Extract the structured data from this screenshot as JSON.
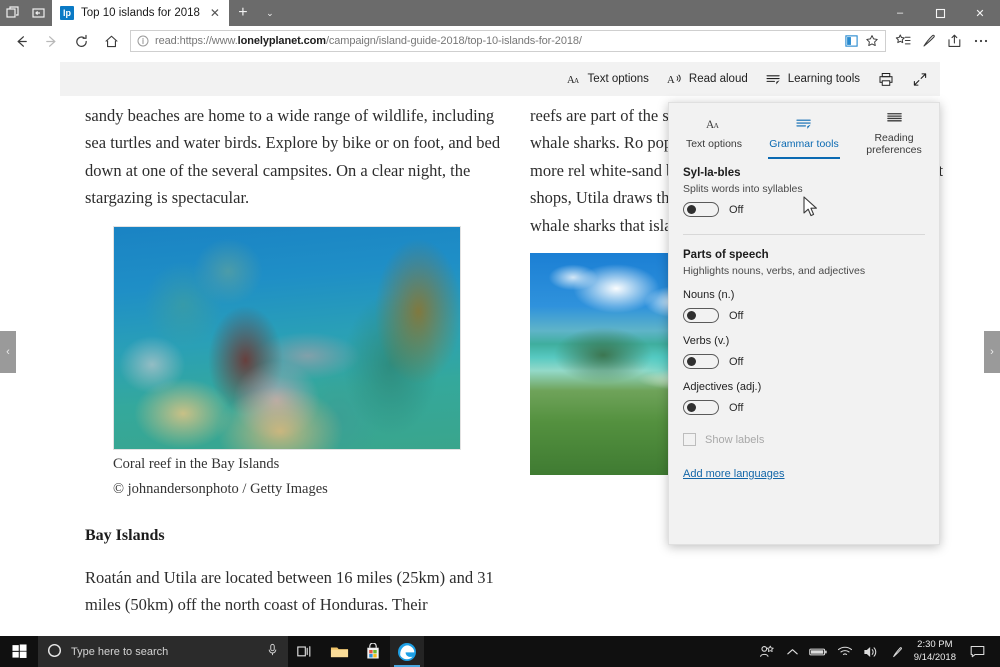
{
  "window": {
    "controls": {
      "minimize": "–",
      "maximize": "❐",
      "close": "✕"
    }
  },
  "tabbar": {
    "tab_title": "Top 10 islands for 2018",
    "favicon_text": "lp",
    "close_label": "✕",
    "new_tab_label": "+",
    "tab_menu_caret": "⌄"
  },
  "navbar": {
    "back_label": "←",
    "forward_label": "→",
    "refresh_label": "⟳",
    "home_label": "⌂",
    "url_prefix": "read:https://www.",
    "url_domain": "lonelyplanet.com",
    "url_path": "/campaign/island-guide-2018/top-10-islands-for-2018/",
    "url_full": "read:https://www.lonelyplanet.com/campaign/island-guide-2018/top-10-islands-for-2018/",
    "reading_view_title": "Reading view",
    "favorite_title": "Add to favorites",
    "favorites_hub_title": "Favorites",
    "web_note_title": "Make a Web Note",
    "share_title": "Share",
    "settings_title": "Settings and more"
  },
  "readbar": {
    "items": [
      {
        "label": "Text options",
        "icon": "text-options-icon"
      },
      {
        "label": "Read aloud",
        "icon": "read-aloud-icon"
      },
      {
        "label": "Learning tools",
        "icon": "learning-tools-icon"
      }
    ],
    "print_title": "Print",
    "fullscreen_title": "Full screen"
  },
  "sidenav": {
    "prev": "‹",
    "next": "›"
  },
  "article": {
    "left_paragraph": "sandy beaches are home to a wide range of wildlife, including sea turtles and water birds. Explore by bike or on foot, and bed down at one of the several campsites. On a clear night, the stargazing is spectacular.",
    "figure_caption": "Coral reef in the Bay Islands",
    "figure_credit": "© johnandersonphoto / Getty Images",
    "section_heading": "Bay Islands",
    "left_paragraph_2": "Roatán and Utila are located between 16 miles (25km) and 31 miles (50km) off the north coast of Honduras. Their",
    "right_paragraph": "reefs are part of the secon world, and teem with fish and even whale sharks. Ro popular of the group and i snorkeling. For a more rel white-sand beach of the W beaches and dozens of hot shops, Utila draws the bac fantastic diving spots, and juvenile whale sharks that island."
  },
  "flyout": {
    "tabs": [
      {
        "label": "Text options",
        "icon": "text-options-icon",
        "active": false
      },
      {
        "label": "Grammar tools",
        "icon": "grammar-tools-icon",
        "active": true
      },
      {
        "label": "Reading preferences",
        "icon": "reading-preferences-icon",
        "active": false
      }
    ],
    "syllables": {
      "heading": "Syl-la-bles",
      "description": "Splits words into syllables",
      "toggle_state": "Off"
    },
    "parts_of_speech": {
      "heading": "Parts of speech",
      "description": "Highlights nouns, verbs, and adjectives",
      "options": [
        {
          "label": "Nouns (n.)",
          "toggle_state": "Off"
        },
        {
          "label": "Verbs (v.)",
          "toggle_state": "Off"
        },
        {
          "label": "Adjectives (adj.)",
          "toggle_state": "Off"
        }
      ],
      "show_labels": "Show labels"
    },
    "add_languages_link": "Add more languages"
  },
  "taskbar": {
    "search_placeholder": "Type here to search",
    "cortana_icon": "cortana-circle-icon",
    "mic_icon": "microphone-icon",
    "task_view_icon": "task-view-icon",
    "file_explorer_icon": "file-explorer-icon",
    "store_icon": "microsoft-store-icon",
    "edge_icon": "edge-browser-icon",
    "tray": {
      "people_icon": "people-icon",
      "chevron_up": "⌃",
      "battery_icon": "battery-icon",
      "network_icon": "wifi-icon",
      "volume_icon": "volume-icon",
      "pen_icon": "pen-icon",
      "time": "2:30 PM",
      "date": "9/14/2018",
      "action_center_icon": "action-center-icon"
    }
  },
  "colors": {
    "accent_blue": "#0b6ab2",
    "titlebar_gray": "#6b6b6b",
    "readbar_gray": "#f2f2f2",
    "flyout_gray": "#f2f2f2",
    "taskbar_black": "#101010",
    "link_blue": "#1266a8"
  }
}
